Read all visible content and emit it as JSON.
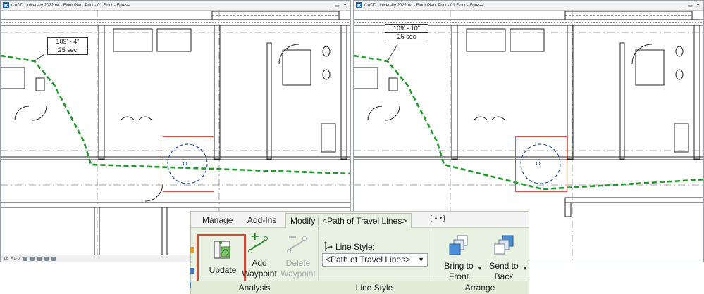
{
  "left_window": {
    "title": "CADD University 2022.rvt - Floor Plan: Print - 01 Floor - Egress",
    "tag": {
      "distance": "109' - 4\"",
      "time": "25 sec"
    },
    "scale": "1/8\" = 1'-0\""
  },
  "right_window": {
    "title": "CADD University 2022.rvt - Floor Plan: Print - 01 Floor - Egress",
    "tag": {
      "distance": "109' - 10\"",
      "time": "25 sec"
    }
  },
  "app_logo": "R",
  "window_controls": [
    "–",
    "▭",
    "✕"
  ],
  "ribbon": {
    "tabs": [
      "Manage",
      "Add-Ins",
      "Modify | <Path of Travel Lines>"
    ],
    "tab_control": "▲ ▾",
    "panels": {
      "analysis": {
        "label": "Analysis",
        "update": "Update",
        "add_waypoint": [
          "Add",
          "Waypoint"
        ],
        "delete_waypoint": [
          "Delete",
          "Waypoint"
        ]
      },
      "line_style": {
        "label": "Line Style",
        "field_label": "Line Style:",
        "value": "<Path of Travel Lines>"
      },
      "arrange": {
        "label": "Arrange",
        "bring_to_front": [
          "Bring to",
          "Front"
        ],
        "send_to_back": [
          "Send to",
          "Back"
        ]
      }
    }
  },
  "colors": {
    "path": "#1f9a2a",
    "highlight": "#d9534f",
    "update_border": "#e0453b",
    "ribbon_bg": "#e9f2e2"
  }
}
